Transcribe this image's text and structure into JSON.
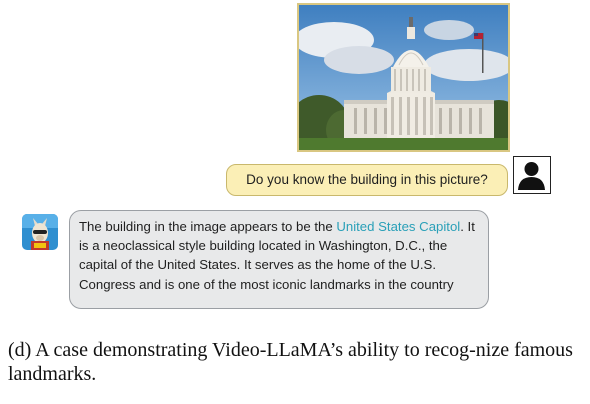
{
  "user_message": {
    "text": "Do you know the building in this picture?",
    "avatar_icon": "user-silhouette-icon",
    "image_icon": "us-capitol-photo"
  },
  "assistant_message": {
    "avatar_icon": "llama-avatar-icon",
    "text_before": "The building in the image appears to be the ",
    "highlight": "United States Capitol",
    "text_after": ". It is a neoclassical style building located in Washington, D.C., the capital of the United States. It serves as the home of the U.S. Congress and is one of the most iconic landmarks in the country",
    "highlight_color": "#2aa0b8"
  },
  "caption": {
    "text": "(d)  A case demonstrating Video-LLaMA’s ability to recog-nize famous landmarks."
  },
  "colors": {
    "user_bubble_bg": "#fbefb6",
    "assistant_bubble_bg": "#e8e9ea",
    "image_border": "#d9c782"
  }
}
